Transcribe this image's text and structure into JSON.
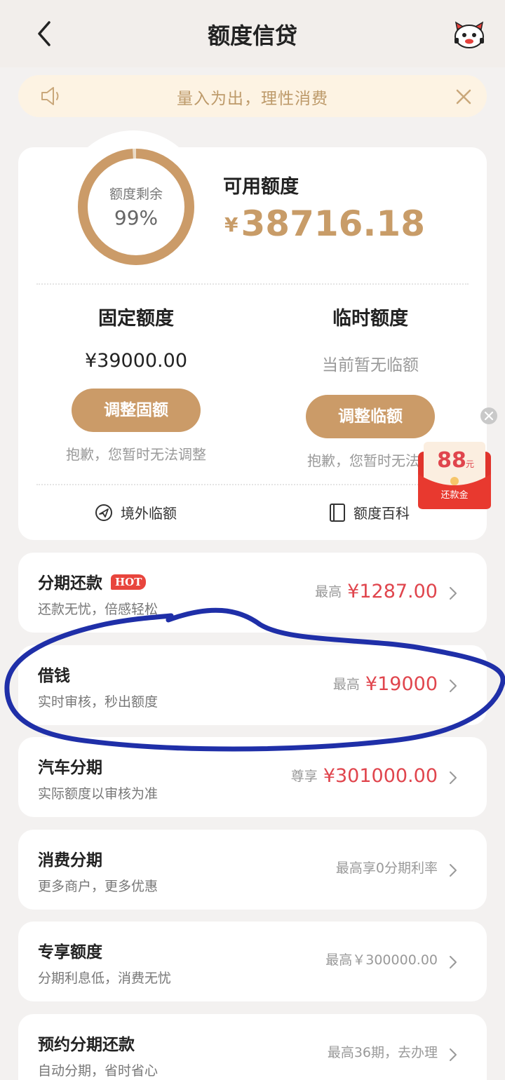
{
  "header": {
    "title": "额度信贷",
    "back_icon": "chevron-left-icon",
    "mascot_icon": "mascot-icon"
  },
  "notice": {
    "text": "量入为出，理性消费",
    "speaker_icon": "speaker-icon",
    "close_icon": "close-icon"
  },
  "summary": {
    "ring_label": "额度剩余",
    "ring_percent_text": "99%",
    "ring_fraction": 0.99,
    "available_label": "可用额度",
    "currency": "¥",
    "available_amount": "38716.18"
  },
  "fixed": {
    "title": "固定额度",
    "value": "¥39000.00",
    "button": "调整固额",
    "note": "抱歉，您暂时无法调整"
  },
  "temporary": {
    "title": "临时额度",
    "value": "当前暂无临额",
    "button": "调整临额",
    "note": "抱歉，您暂时无法调"
  },
  "links": {
    "overseas": "境外临额",
    "wiki": "额度百科"
  },
  "red_packet": {
    "amount": "88",
    "unit": "元",
    "label": "还款金"
  },
  "items": [
    {
      "title": "分期还款",
      "badge": "HOT",
      "sub": "还款无忧，倍感轻松",
      "prefix": "最高",
      "amount": "¥1287.00"
    },
    {
      "title": "借钱",
      "sub": "实时审核，秒出额度",
      "prefix": "最高",
      "amount": "¥19000"
    },
    {
      "title": "汽车分期",
      "sub": "实际额度以审核为准",
      "prefix": "尊享",
      "amount": "¥301000.00"
    },
    {
      "title": "消费分期",
      "sub": "更多商户，更多优惠",
      "prefix": "最高享0分期利率",
      "amount": ""
    },
    {
      "title": "专享额度",
      "sub": "分期利息低，消费无忧",
      "prefix": "最高￥300000.00",
      "amount": ""
    },
    {
      "title": "预约分期还款",
      "sub": "自动分期，省时省心",
      "prefix": "最高36期，去办理",
      "amount": ""
    }
  ],
  "colors": {
    "accent": "#cb9b68",
    "red": "#e0454d",
    "scribble": "#1f2fa8"
  }
}
